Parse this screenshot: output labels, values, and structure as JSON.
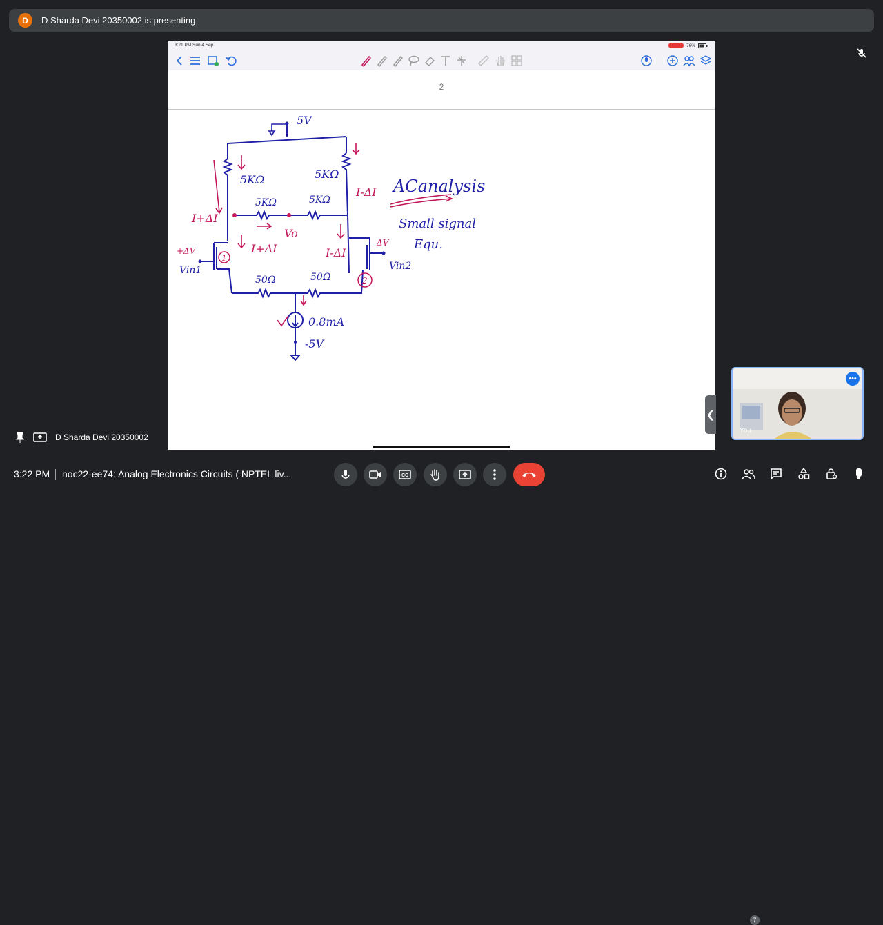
{
  "top_banner": {
    "avatar_initial": "D",
    "text": "D Sharda Devi 20350002 is presenting"
  },
  "tablet": {
    "status_time": "3:21 PM  Sun 4 Sep",
    "battery": "76%",
    "page_number": "2",
    "toolbar_left_icons": [
      "back-icon",
      "list-icon",
      "thumbnails-icon",
      "undo-icon"
    ],
    "toolbar_center_icons": [
      "pen-icon",
      "pencil-icon",
      "highlighter-icon",
      "lasso-icon",
      "eraser-icon",
      "text-icon",
      "shape-icon",
      "ruler-icon",
      "hand-icon",
      "image-icon"
    ],
    "toolbar_right_icons": [
      "mic-icon",
      "add-page-icon",
      "share-icon",
      "layers-icon"
    ],
    "notes": {
      "supply_top": "5V",
      "r_top_left": "5KΩ",
      "r_top_right": "5KΩ",
      "r_mid_left": "5KΩ",
      "r_mid_right": "5KΩ",
      "left_current": "I+ΔI",
      "vo": "Vo",
      "left_branch_current": "I+ΔI",
      "right_branch_current": "I-ΔI",
      "ac_current": "I-ΔI",
      "ac_title": "ACanalysis",
      "small_signal": "Small signal",
      "equ": "Equ.",
      "vin1_delta": "+ΔV",
      "vin1": "Vin1",
      "vin2_delta": "-ΔV",
      "vin2": "Vin2",
      "transistor1": "1",
      "transistor2": "2",
      "r_bot_left": "50Ω",
      "r_bot_right": "50Ω",
      "current_source": "0.8mA",
      "supply_bottom": "-5V"
    }
  },
  "self_view": {
    "label": "You"
  },
  "presenter": {
    "name": "D Sharda Devi 20350002"
  },
  "bottom_bar": {
    "time": "3:22 PM",
    "meeting_title": "noc22-ee74: Analog Electronics Circuits ( NPTEL liv...",
    "participants_count": "7"
  },
  "colors": {
    "accent": "#1a73e8",
    "end_call": "#ea4335",
    "ink_blue": "#1f1fa8",
    "ink_red": "#c2185b"
  }
}
